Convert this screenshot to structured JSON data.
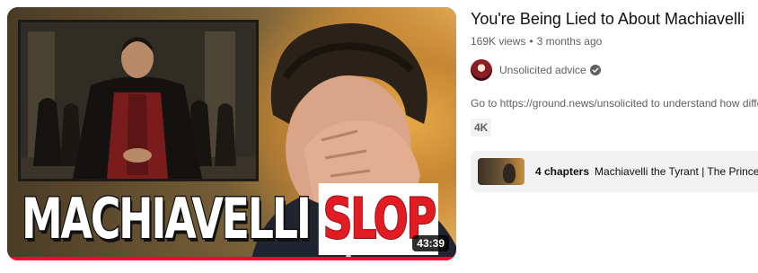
{
  "thumbnail": {
    "overlay_text_white": "MACHIAVELLI",
    "overlay_text_red": "SLOP",
    "duration": "43:39",
    "watch_progress_pct": 100
  },
  "video": {
    "title": "You're Being Lied to About Machiavelli",
    "views": "169K views",
    "age": "3 months ago",
    "separator": "•"
  },
  "channel": {
    "name": "Unsolicited advice",
    "verified": true,
    "avatar_icon": "channel-avatar"
  },
  "description": "Go to https://ground.news/unsolicited to understand how different",
  "badges": [
    "4K"
  ],
  "chapters": {
    "count_label": "4 chapters",
    "names": "Machiavelli the Tyrant | The Prince"
  },
  "colors": {
    "progress": "#ff0033",
    "title_red": "#e31b23",
    "secondary_text": "#606060",
    "chip_bg": "#f2f2f2"
  }
}
